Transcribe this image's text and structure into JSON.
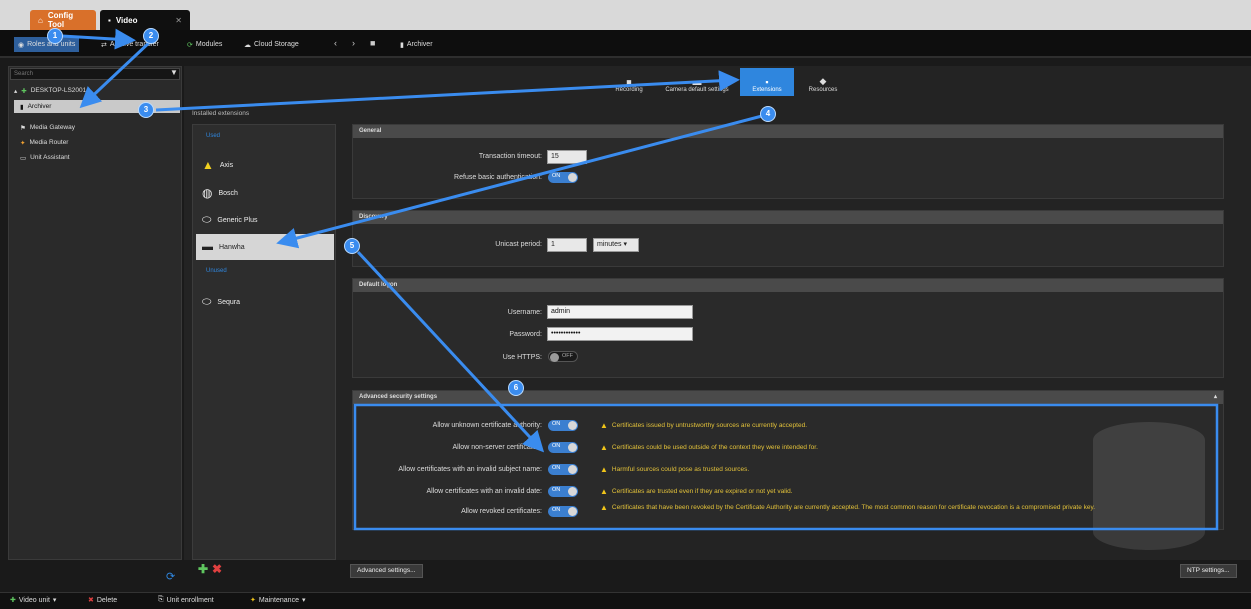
{
  "app_tabs": [
    {
      "label": "Config Tool"
    },
    {
      "label": "Video"
    }
  ],
  "tasks": {
    "items": [
      "Roles and units",
      "Archive transfer",
      "Modules",
      "Cloud Storage"
    ],
    "breadcrumb": "Archiver"
  },
  "tree": {
    "search_placeholder": "Search",
    "server": "DESKTOP-LS2001",
    "items": [
      "Archiver",
      "Media Gateway",
      "Media Router",
      "Unit Assistant"
    ]
  },
  "view_tabs": [
    "Recording",
    "Camera default settings",
    "Extensions",
    "Resources"
  ],
  "extensions": {
    "header": "Installed extensions",
    "groups": [
      {
        "name": "Used",
        "items": [
          "Axis",
          "Bosch",
          "Generic Plus",
          "Hanwha"
        ]
      },
      {
        "name": "Unused",
        "items": [
          "Sequra"
        ]
      }
    ]
  },
  "general": {
    "title": "General",
    "timeout_label": "Transaction timeout:",
    "timeout_value": "15",
    "refuse_label": "Refuse basic authentication:",
    "refuse_state": "ON"
  },
  "discovery": {
    "title": "Discovery",
    "period_label": "Unicast period:",
    "period_value": "1",
    "period_unit": "minutes"
  },
  "default_logon": {
    "title": "Default logon",
    "username_label": "Username:",
    "username_value": "admin",
    "password_label": "Password:",
    "password_value": "••••••••••••",
    "https_label": "Use HTTPS:",
    "https_state": "OFF"
  },
  "advanced_security": {
    "title": "Advanced security settings",
    "rows": [
      {
        "label": "Allow unknown certificate authority:",
        "state": "ON",
        "warning": "Certificates issued by untrustworthy sources are currently accepted."
      },
      {
        "label": "Allow non-server certificates:",
        "state": "ON",
        "warning": "Certificates could be used outside of the context they were intended for."
      },
      {
        "label": "Allow certificates with an invalid subject name:",
        "state": "ON",
        "warning": "Harmful sources could pose as trusted sources."
      },
      {
        "label": "Allow certificates with an invalid date:",
        "state": "ON",
        "warning": "Certificates are trusted even if they are expired or not yet valid."
      },
      {
        "label": "Allow revoked certificates:",
        "state": "ON",
        "warning": "Certificates that have been revoked by the Certificate Authority are currently accepted. The most common reason for certificate revocation is a compromised private key."
      }
    ]
  },
  "buttons": {
    "advanced": "Advanced settings...",
    "ntp": "NTP settings..."
  },
  "status_bar": [
    "Video unit",
    "Delete",
    "Unit enrollment",
    "Maintenance"
  ],
  "callouts": [
    "1",
    "2",
    "3",
    "4",
    "5",
    "6"
  ],
  "colors": {
    "accent": "#2f86de",
    "warning": "#e3c23a",
    "config_tab": "#d9702a"
  }
}
